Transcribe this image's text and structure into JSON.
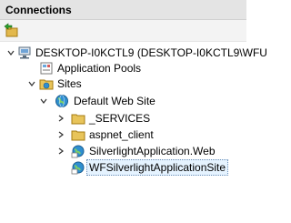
{
  "panel": {
    "title": "Connections"
  },
  "toolbar": {
    "connect_icon": "connect-icon"
  },
  "tree": {
    "server": "DESKTOP-I0KCTL9 (DESKTOP-I0KCTL9\\WFU",
    "app_pools": "Application Pools",
    "sites": "Sites",
    "default_site": "Default Web Site",
    "children": [
      "_SERVICES",
      "aspnet_client",
      "SilverlightApplication.Web",
      "WFSilverlightApplicationSite"
    ]
  },
  "colors": {
    "folder": "#e8c45a",
    "globe": "#2f8fd0",
    "selection": "#e5f3ff"
  }
}
